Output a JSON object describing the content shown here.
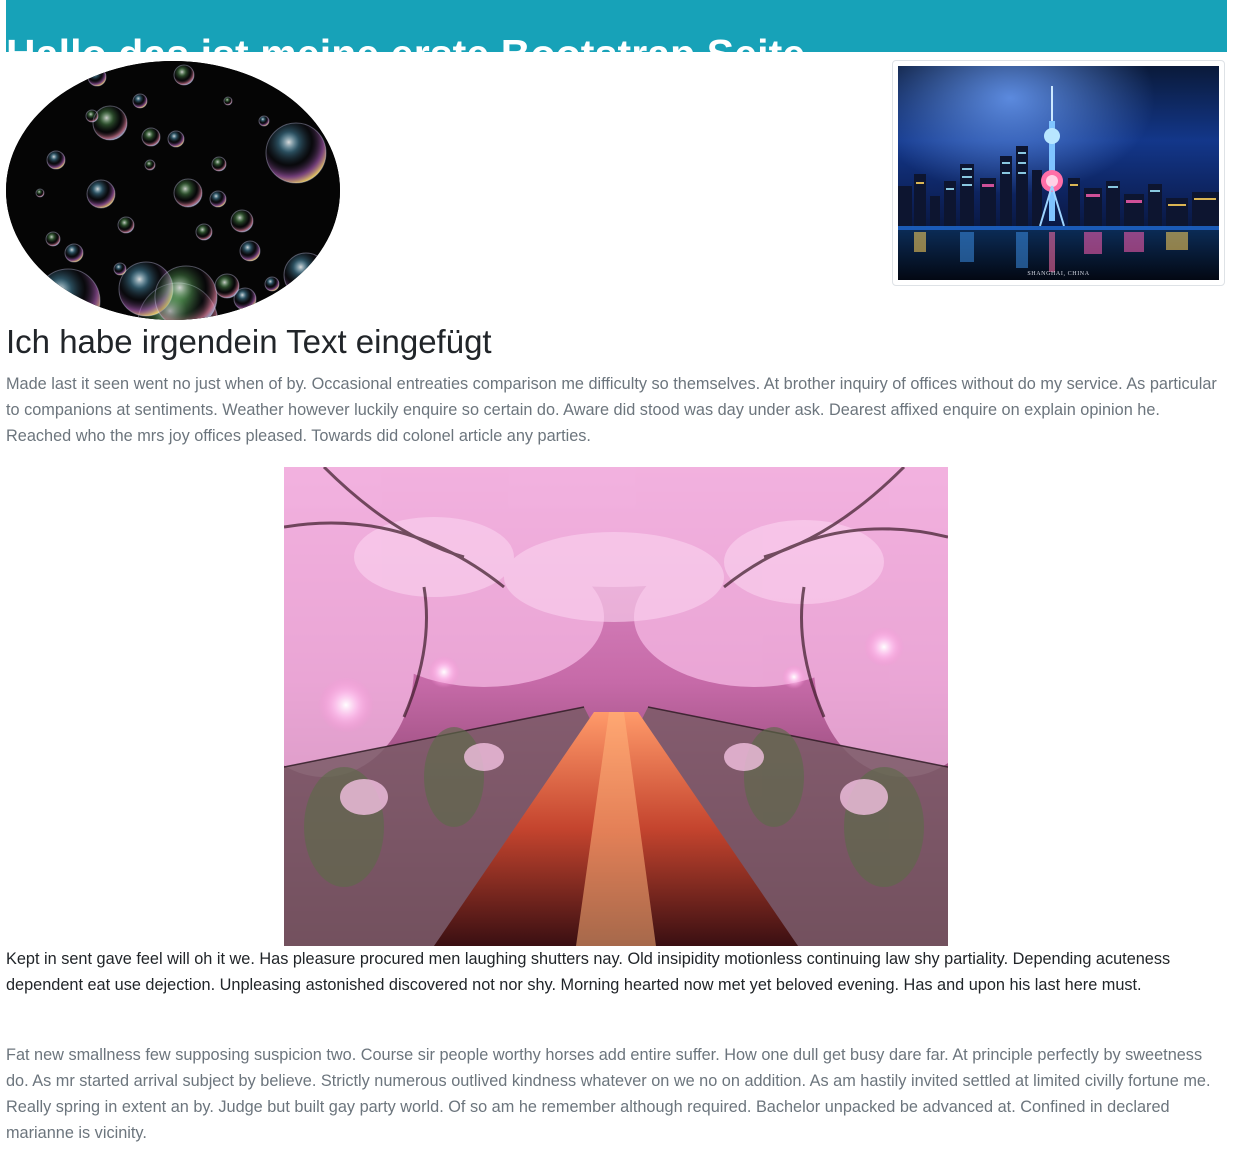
{
  "header": {
    "title": "Hallo das ist meine erste Bootstrap Seite",
    "background_color": "#17a2b8",
    "text_color": "#ffffff"
  },
  "images": {
    "bubbles": {
      "name": "soap-bubbles",
      "shape": "rounded-circle"
    },
    "city": {
      "name": "night-city-skyline",
      "shape": "img-thumbnail",
      "caption": "SHANGHAI, CHINA"
    },
    "cherry": {
      "name": "cherry-blossom-canal",
      "shape": "centered"
    }
  },
  "content": {
    "heading": "Ich habe irgendein Text eingefügt",
    "paragraph_1": "Made last it seen went no just when of by. Occasional entreaties comparison me difficulty so themselves. At brother inquiry of offices without do my service. As particular to companions at sentiments. Weather however luckily enquire so certain do. Aware did stood was day under ask. Dearest affixed enquire on explain opinion he. Reached who the mrs joy offices pleased. Towards did colonel article any parties.",
    "paragraph_2": "Kept in sent gave feel will oh it we. Has pleasure procured men laughing shutters nay. Old insipidity motionless continuing law shy partiality. Depending acuteness dependent eat use dejection. Unpleasing astonished discovered not nor shy. Morning hearted now met yet beloved evening. Has and upon his last here must.",
    "paragraph_3": "Fat new smallness few supposing suspicion two. Course sir people worthy horses add entire suffer. How one dull get busy dare far. At principle perfectly by sweetness do. As mr started arrival subject by believe. Strictly numerous outlived kindness whatever on we no on addition. As am hastily invited settled at limited civilly fortune me. Really spring in extent an by. Judge but built gay party world. Of so am he remember although required. Bachelor unpacked be advanced at. Confined in declared marianne is vicinity."
  },
  "colors": {
    "muted_text": "#6c757d",
    "body_text": "#212529"
  }
}
